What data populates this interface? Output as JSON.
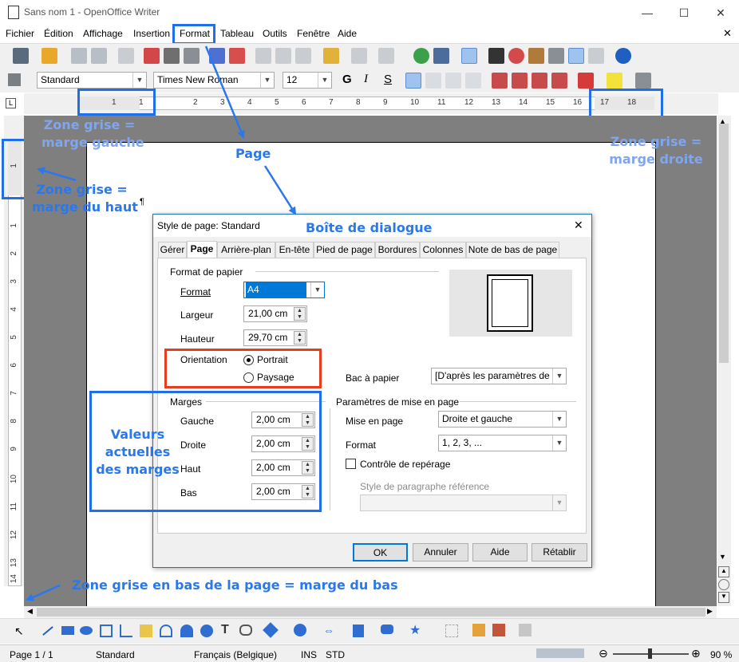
{
  "window": {
    "title": "Sans nom 1 - OpenOffice Writer",
    "minimize": "—",
    "maximize": "☐",
    "close": "✕"
  },
  "menu": {
    "items": [
      "Fichier",
      "Édition",
      "Affichage",
      "Insertion",
      "Format",
      "Tableau",
      "Outils",
      "Fenêtre",
      "Aide"
    ],
    "close_doc": "✕"
  },
  "formatting": {
    "style": "Standard",
    "font": "Times New Roman",
    "size": "12"
  },
  "ruler": {
    "h_ticks": [
      "1",
      "1",
      "2",
      "3",
      "4",
      "5",
      "6",
      "7",
      "8",
      "9",
      "10",
      "11",
      "12",
      "13",
      "14",
      "15",
      "16",
      "17",
      "18"
    ],
    "v_ticks": [
      "1",
      "1",
      "2",
      "3",
      "4",
      "5",
      "6",
      "7",
      "8",
      "9",
      "10",
      "11",
      "12",
      "13",
      "14"
    ]
  },
  "dialog": {
    "title": "Style de page: Standard",
    "tabs": [
      "Gérer",
      "Page",
      "Arrière-plan",
      "En-tête",
      "Pied de page",
      "Bordures",
      "Colonnes",
      "Note de bas de page"
    ],
    "active_tab": "Page",
    "paper_section": "Format de papier",
    "format_label": "Format",
    "format_value": "A4",
    "width_label": "Largeur",
    "width_value": "21,00 cm",
    "height_label": "Hauteur",
    "height_value": "29,70 cm",
    "orientation_label": "Orientation",
    "portrait": "Portrait",
    "landscape": "Paysage",
    "tray_label": "Bac à papier",
    "tray_value": "[D'après les paramètres de l'",
    "margins_section": "Marges",
    "margins": [
      {
        "label": "Gauche",
        "value": "2,00 cm"
      },
      {
        "label": "Droite",
        "value": "2,00 cm"
      },
      {
        "label": "Haut",
        "value": "2,00 cm"
      },
      {
        "label": "Bas",
        "value": "2,00 cm"
      }
    ],
    "layout_section": "Paramètres de mise en page",
    "layout_label": "Mise en page",
    "layout_value": "Droite et gauche",
    "numfmt_label": "Format",
    "numfmt_value": "1, 2, 3, ...",
    "register_label": "Contrôle de repérage",
    "refstyle_label": "Style de paragraphe référence",
    "buttons": {
      "ok": "OK",
      "cancel": "Annuler",
      "help": "Aide",
      "reset": "Rétablir"
    }
  },
  "annotations": {
    "left_margin": "Zone grise =\nmarge gauche",
    "right_margin": "Zone grise =\nmarge droite",
    "top_margin": "Zone grise =\nmarge du haut",
    "page": "Page",
    "dialog_box": "Boîte de dialogue",
    "current_margins": "Valeurs\nactuelles\ndes marges",
    "bottom_margin": "Zone grise en bas de la page = marge du bas"
  },
  "status": {
    "page": "Page 1 / 1",
    "style": "Standard",
    "language": "Français (Belgique)",
    "ins": "INS",
    "std": "STD",
    "zoom": "90 %"
  },
  "colors": {
    "annotation": "#2a78ec",
    "highlight": "#1e6fe8",
    "red_box": "#e53d1d",
    "gray_area": "#7f7f7f"
  }
}
